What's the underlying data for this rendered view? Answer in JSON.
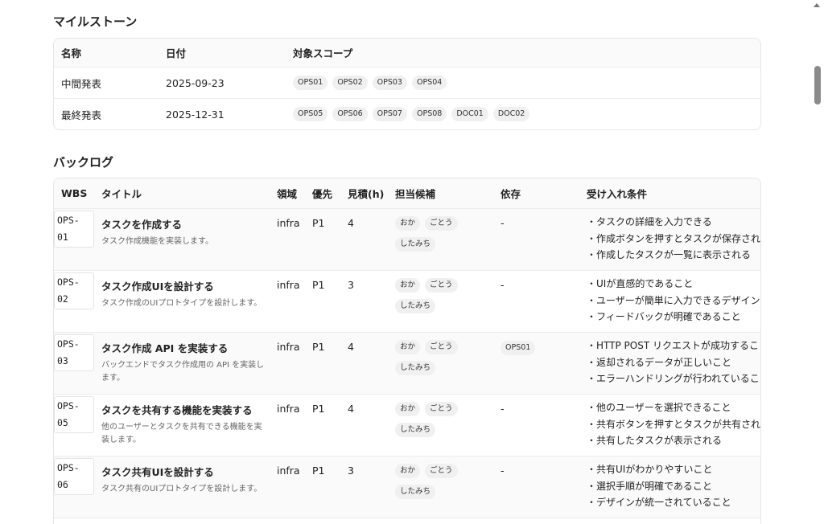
{
  "milestones": {
    "title": "マイルストーン",
    "headers": {
      "name": "名称",
      "date": "日付",
      "scope": "対象スコープ"
    },
    "rows": [
      {
        "name": "中間発表",
        "date": "2025-09-23",
        "scopes": [
          "OPS01",
          "OPS02",
          "OPS03",
          "OPS04"
        ]
      },
      {
        "name": "最終発表",
        "date": "2025-12-31",
        "scopes": [
          "OPS05",
          "OPS06",
          "OPS07",
          "OPS08",
          "DOC01",
          "DOC02"
        ]
      }
    ]
  },
  "backlog": {
    "title": "バックログ",
    "headers": {
      "wbs": "WBS",
      "title": "タイトル",
      "area": "領域",
      "priority": "優先",
      "estimate": "見積(h)",
      "candidates": "担当候補",
      "deps": "依存",
      "criteria": "受け入れ条件"
    },
    "rows": [
      {
        "wbs": "OPS-\n01",
        "title": "タスクを作成する",
        "desc": "タスク作成機能を実装します。",
        "area": "infra",
        "priority": "P1",
        "estimate": "4",
        "candidates": [
          "おか",
          "ごとう",
          "したみち"
        ],
        "deps": "-",
        "dep_pill": "",
        "criteria": [
          "・タスクの詳細を入力できる",
          "・作成ボタンを押すとタスクが保存される",
          "・作成したタスクが一覧に表示される"
        ]
      },
      {
        "wbs": "OPS-\n02",
        "title": "タスク作成UIを設計する",
        "desc": "タスク作成のUIプロトタイプを設計します。",
        "area": "infra",
        "priority": "P1",
        "estimate": "3",
        "candidates": [
          "おか",
          "ごとう",
          "したみち"
        ],
        "deps": "-",
        "dep_pill": "",
        "criteria": [
          "・UIが直感的であること",
          "・ユーザーが簡単に入力できるデザイン",
          "・フィードバックが明確であること"
        ]
      },
      {
        "wbs": "OPS-\n03",
        "title": "タスク作成 API を実装する",
        "desc": "バックエンドでタスク作成用の API を実装します。",
        "area": "infra",
        "priority": "P1",
        "estimate": "4",
        "candidates": [
          "おか",
          "ごとう",
          "したみち"
        ],
        "deps": "",
        "dep_pill": "OPS01",
        "criteria": [
          "・HTTP POST リクエストが成功すること",
          "・返却されるデータが正しいこと",
          "・エラーハンドリングが行われていること"
        ]
      },
      {
        "wbs": "OPS-\n05",
        "title": "タスクを共有する機能を実装する",
        "desc": "他のユーザーとタスクを共有できる機能を実装します。",
        "area": "infra",
        "priority": "P1",
        "estimate": "4",
        "candidates": [
          "おか",
          "ごとう",
          "したみち"
        ],
        "deps": "-",
        "dep_pill": "",
        "criteria": [
          "・他のユーザーを選択できること",
          "・共有ボタンを押すとタスクが共有される",
          "・共有したタスクが表示される"
        ]
      },
      {
        "wbs": "OPS-\n06",
        "title": "タスク共有UIを設計する",
        "desc": "タスク共有のUIプロトタイプを設計します。",
        "area": "infra",
        "priority": "P1",
        "estimate": "3",
        "candidates": [
          "おか",
          "ごとう",
          "したみち"
        ],
        "deps": "-",
        "dep_pill": "",
        "criteria": [
          "・共有UIがわかりやすいこと",
          "・選択手順が明確であること",
          "・デザインが統一されていること"
        ]
      }
    ]
  }
}
